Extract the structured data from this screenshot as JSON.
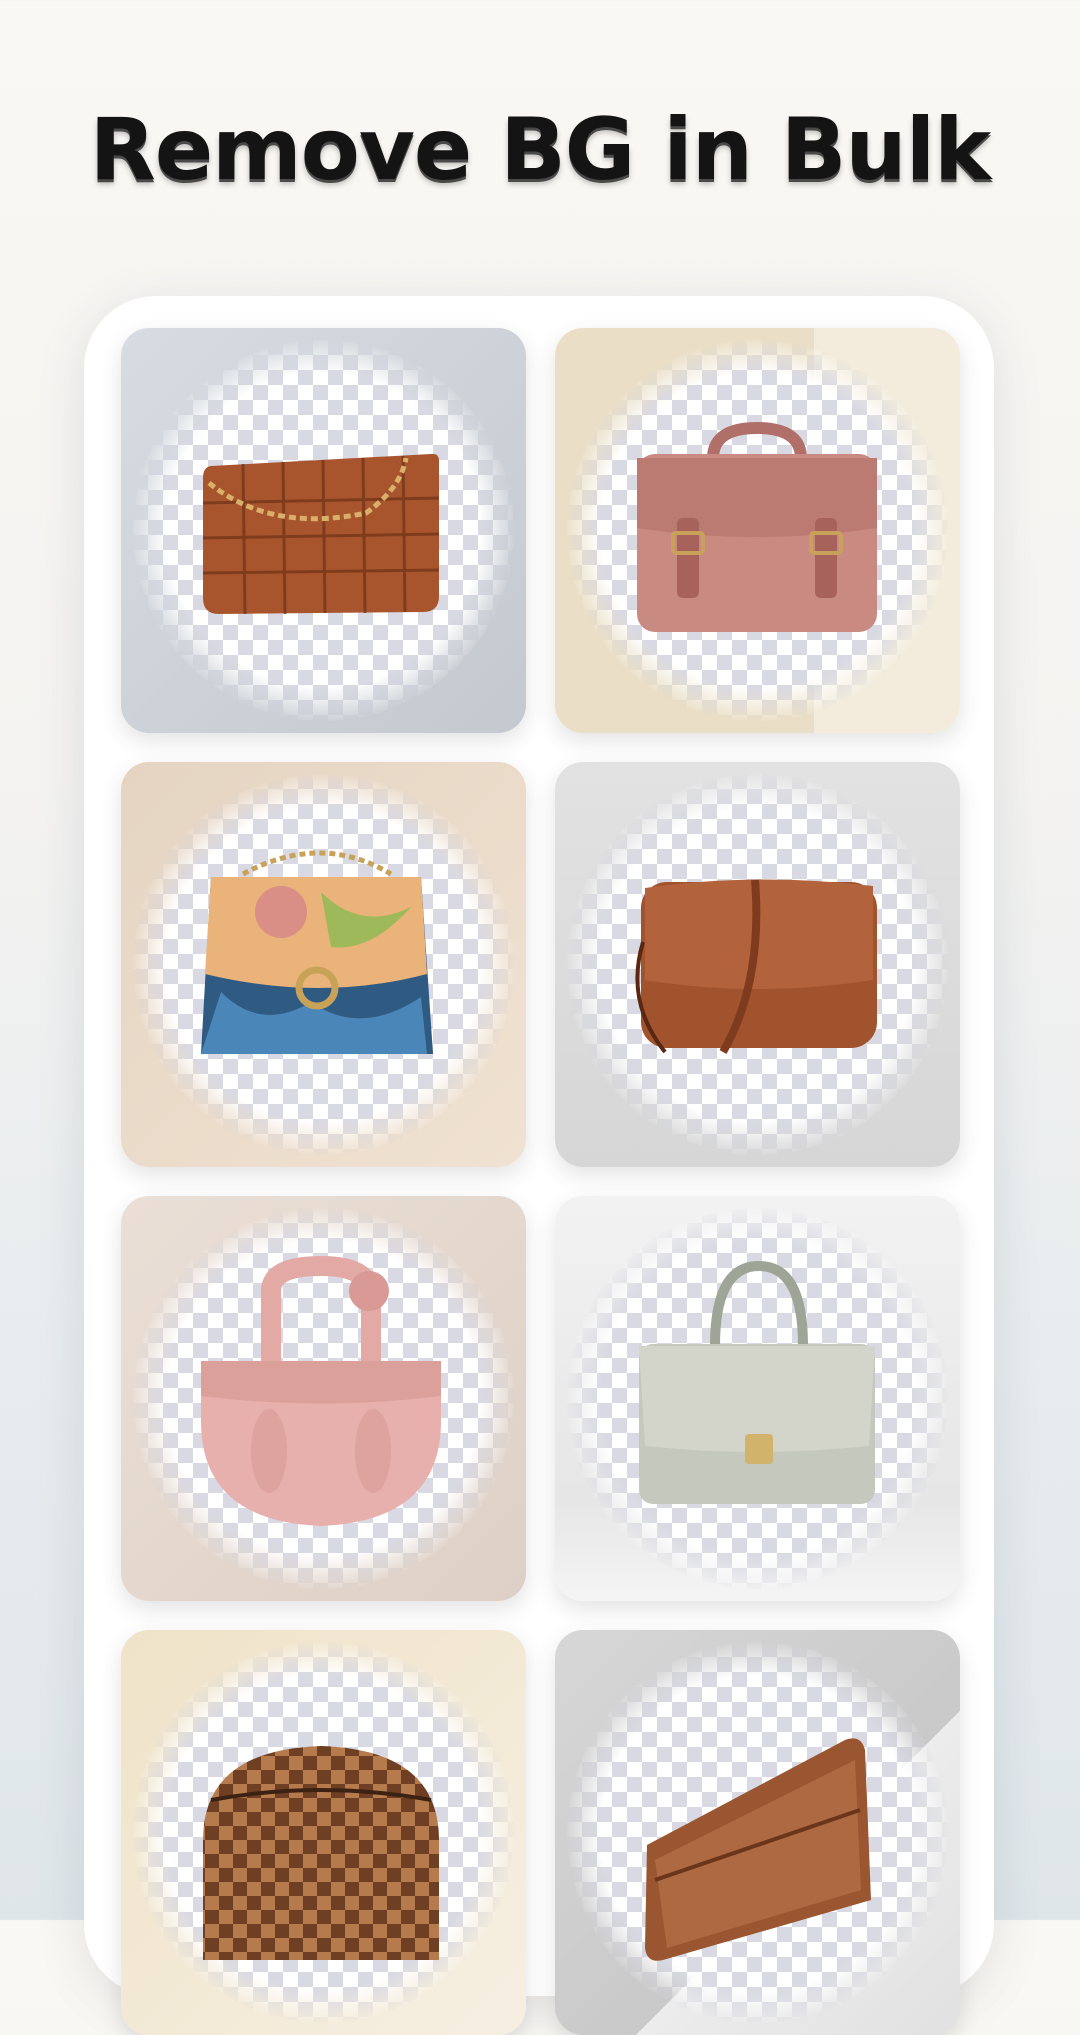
{
  "headline": "Remove BG in Bulk",
  "tiles": [
    {
      "name": "woven-tote-bag",
      "bg": "#cfd4da",
      "color": "#a8552e"
    },
    {
      "name": "pink-satchel-bag",
      "bg": "#ece3cf",
      "color": "#c98a82"
    },
    {
      "name": "floral-flap-bag",
      "bg": "#eddcc9",
      "color": "#c8a27a"
    },
    {
      "name": "brown-crossbody-bag",
      "bg": "#dcdcdc",
      "color": "#a1532e"
    },
    {
      "name": "pink-knot-handbag",
      "bg": "#e7ddd4",
      "color": "#e7b0ac"
    },
    {
      "name": "silver-top-handle-bag",
      "bg": "#ededed",
      "color": "#c5c8bd"
    },
    {
      "name": "checkered-pouch",
      "bg": "#f2e8d6",
      "color": "#8f5a35"
    },
    {
      "name": "leather-wallet",
      "bg": "#dadada",
      "color": "#9a5531"
    }
  ]
}
